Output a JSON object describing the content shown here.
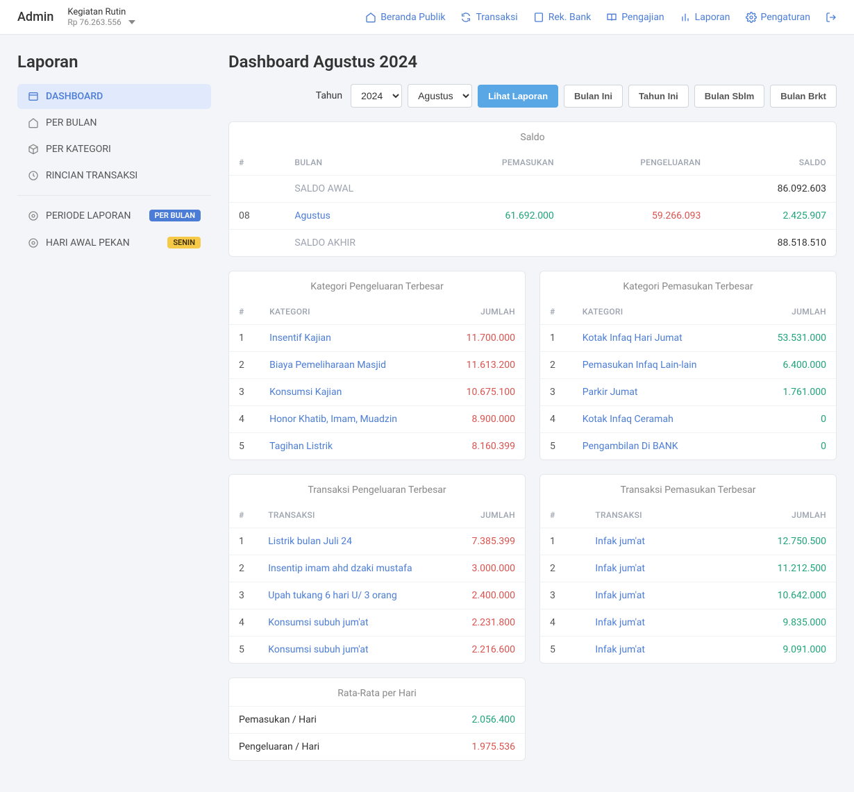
{
  "topbar": {
    "brand": "Admin",
    "org_name": "Kegiatan Rutin",
    "org_balance": "Rp 76.263.556",
    "nav": {
      "beranda": "Beranda Publik",
      "transaksi": "Transaksi",
      "rekbank": "Rek. Bank",
      "pengajian": "Pengajian",
      "laporan": "Laporan",
      "pengaturan": "Pengaturan"
    }
  },
  "sidebar": {
    "title": "Laporan",
    "items": {
      "dashboard": "DASHBOARD",
      "perbulan": "PER BULAN",
      "perkategori": "PER KATEGORI",
      "rincian": "RINCIAN TRANSAKSI",
      "periode": "PERIODE LAPORAN",
      "periode_badge": "PER BULAN",
      "hariawal": "HARI AWAL PEKAN",
      "hariawal_badge": "SENIN"
    }
  },
  "page": {
    "title": "Dashboard Agustus 2024",
    "filter": {
      "tahun_label": "Tahun",
      "tahun_value": "2024",
      "bulan_value": "Agustus",
      "lihat": "Lihat Laporan",
      "bulan_ini": "Bulan Ini",
      "tahun_ini": "Tahun Ini",
      "bulan_sblm": "Bulan Sblm",
      "bulan_brkt": "Bulan Brkt"
    }
  },
  "saldo": {
    "title": "Saldo",
    "headers": {
      "no": "#",
      "bulan": "BULAN",
      "pemasukan": "PEMASUKAN",
      "pengeluaran": "PENGELUARAN",
      "saldo": "SALDO"
    },
    "awal_label": "SALDO AWAL",
    "awal_value": "86.092.603",
    "row": {
      "no": "08",
      "bulan": "Agustus",
      "pemasukan": "61.692.000",
      "pengeluaran": "59.266.093",
      "saldo": "2.425.907"
    },
    "akhir_label": "SALDO AKHIR",
    "akhir_value": "88.518.510"
  },
  "kat_keluar": {
    "title": "Kategori Pengeluaran Terbesar",
    "headers": {
      "no": "#",
      "kategori": "KATEGORI",
      "jumlah": "JUMLAH"
    },
    "rows": [
      {
        "no": "1",
        "name": "Insentif Kajian",
        "amount": "11.700.000"
      },
      {
        "no": "2",
        "name": "Biaya Pemeliharaan Masjid",
        "amount": "11.613.200"
      },
      {
        "no": "3",
        "name": "Konsumsi Kajian",
        "amount": "10.675.100"
      },
      {
        "no": "4",
        "name": "Honor Khatib, Imam, Muadzin",
        "amount": "8.900.000"
      },
      {
        "no": "5",
        "name": "Tagihan Listrik",
        "amount": "8.160.399"
      }
    ]
  },
  "kat_masuk": {
    "title": "Kategori Pemasukan Terbesar",
    "headers": {
      "no": "#",
      "kategori": "KATEGORI",
      "jumlah": "JUMLAH"
    },
    "rows": [
      {
        "no": "1",
        "name": "Kotak Infaq Hari Jumat",
        "amount": "53.531.000"
      },
      {
        "no": "2",
        "name": "Pemasukan Infaq Lain-lain",
        "amount": "6.400.000"
      },
      {
        "no": "3",
        "name": "Parkir Jumat",
        "amount": "1.761.000"
      },
      {
        "no": "4",
        "name": "Kotak Infaq Ceramah",
        "amount": "0"
      },
      {
        "no": "5",
        "name": "Pengambilan Di BANK",
        "amount": "0"
      }
    ]
  },
  "trx_keluar": {
    "title": "Transaksi Pengeluaran Terbesar",
    "headers": {
      "no": "#",
      "transaksi": "TRANSAKSI",
      "jumlah": "JUMLAH"
    },
    "rows": [
      {
        "no": "1",
        "name": "Listrik bulan Juli 24",
        "amount": "7.385.399"
      },
      {
        "no": "2",
        "name": "Insentip imam ahd dzaki mustafa",
        "amount": "3.000.000"
      },
      {
        "no": "3",
        "name": "Upah tukang 6 hari U/ 3 orang",
        "amount": "2.400.000"
      },
      {
        "no": "4",
        "name": "Konsumsi subuh jum'at",
        "amount": "2.231.800"
      },
      {
        "no": "5",
        "name": "Konsumsi subuh jum'at",
        "amount": "2.216.600"
      }
    ]
  },
  "trx_masuk": {
    "title": "Transaksi Pemasukan Terbesar",
    "headers": {
      "no": "#",
      "transaksi": "TRANSAKSI",
      "jumlah": "JUMLAH"
    },
    "rows": [
      {
        "no": "1",
        "name": "Infak jum'at",
        "amount": "12.750.500"
      },
      {
        "no": "2",
        "name": "Infak jum'at",
        "amount": "11.212.500"
      },
      {
        "no": "3",
        "name": "Infak jum'at",
        "amount": "10.642.000"
      },
      {
        "no": "4",
        "name": "Infak jum'at",
        "amount": "9.835.000"
      },
      {
        "no": "5",
        "name": "Infak jum'at",
        "amount": "9.091.000"
      }
    ]
  },
  "avg": {
    "title": "Rata-Rata per Hari",
    "pemasukan_label": "Pemasukan / Hari",
    "pemasukan_value": "2.056.400",
    "pengeluaran_label": "Pengeluaran / Hari",
    "pengeluaran_value": "1.975.536"
  }
}
